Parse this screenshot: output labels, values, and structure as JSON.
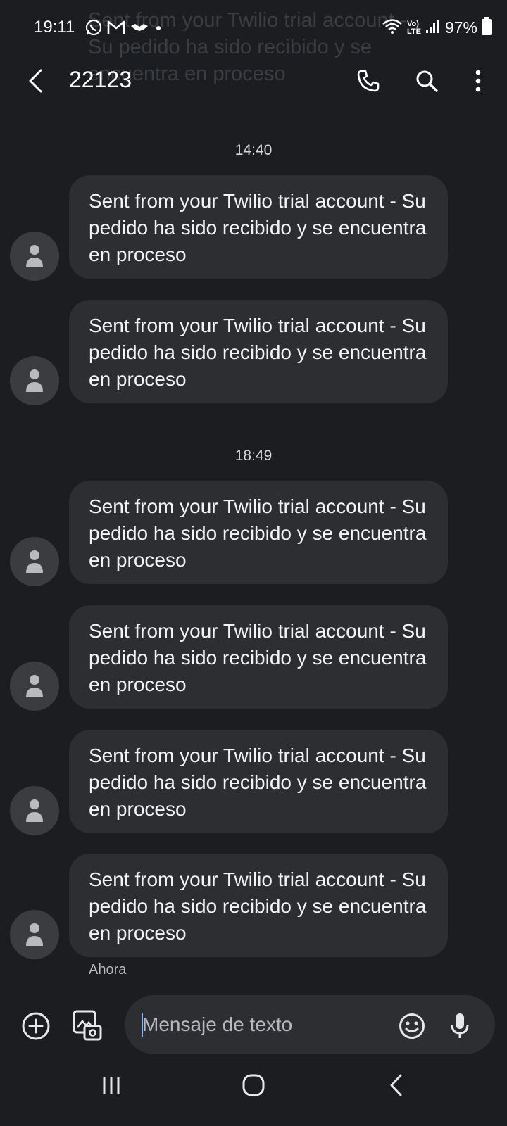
{
  "status_bar": {
    "time": "19:11",
    "battery": "97%",
    "network_badge_top": "Vo)",
    "network_badge_bottom": "LTE"
  },
  "notification_ghost": "Sent from your Twilio trial account - Su pedido ha sido recibido y se encuentra en proceso",
  "header": {
    "title": "22123"
  },
  "conversation": {
    "groups": [
      {
        "time": "14:40",
        "messages": [
          "Sent from your Twilio trial account - Su pedido ha sido recibido y se encuentra en proceso",
          "Sent from your Twilio trial account - Su pedido ha sido recibido y se encuentra en proceso"
        ]
      },
      {
        "time": "18:49",
        "messages": [
          "Sent from your Twilio trial account - Su pedido ha sido recibido y se encuentra en proceso",
          "Sent from your Twilio trial account - Su pedido ha sido recibido y se encuentra en proceso",
          "Sent from your Twilio trial account - Su pedido ha sido recibido y se encuentra en proceso",
          "Sent from your Twilio trial account - Su pedido ha sido recibido y se encuentra en proceso"
        ]
      }
    ],
    "last_status": "Ahora"
  },
  "composer": {
    "placeholder": "Mensaje de texto"
  },
  "icons": {
    "status": [
      "whatsapp-icon",
      "gmail-icon",
      "handshake-icon",
      "dot-icon",
      "wifi-icon",
      "volte-icon",
      "signal-icon",
      "battery-icon"
    ],
    "header": [
      "back-arrow-icon",
      "phone-icon",
      "search-icon",
      "more-vert-icon"
    ],
    "composer": [
      "add-circle-icon",
      "gallery-icon",
      "emoji-icon",
      "mic-icon"
    ],
    "nav": [
      "recents-icon",
      "home-icon",
      "back-icon"
    ]
  },
  "colors": {
    "background": "#1b1d20",
    "bubble": "#2c2e32",
    "avatar": "#3a3c40",
    "accent": "#8ab4f8"
  }
}
